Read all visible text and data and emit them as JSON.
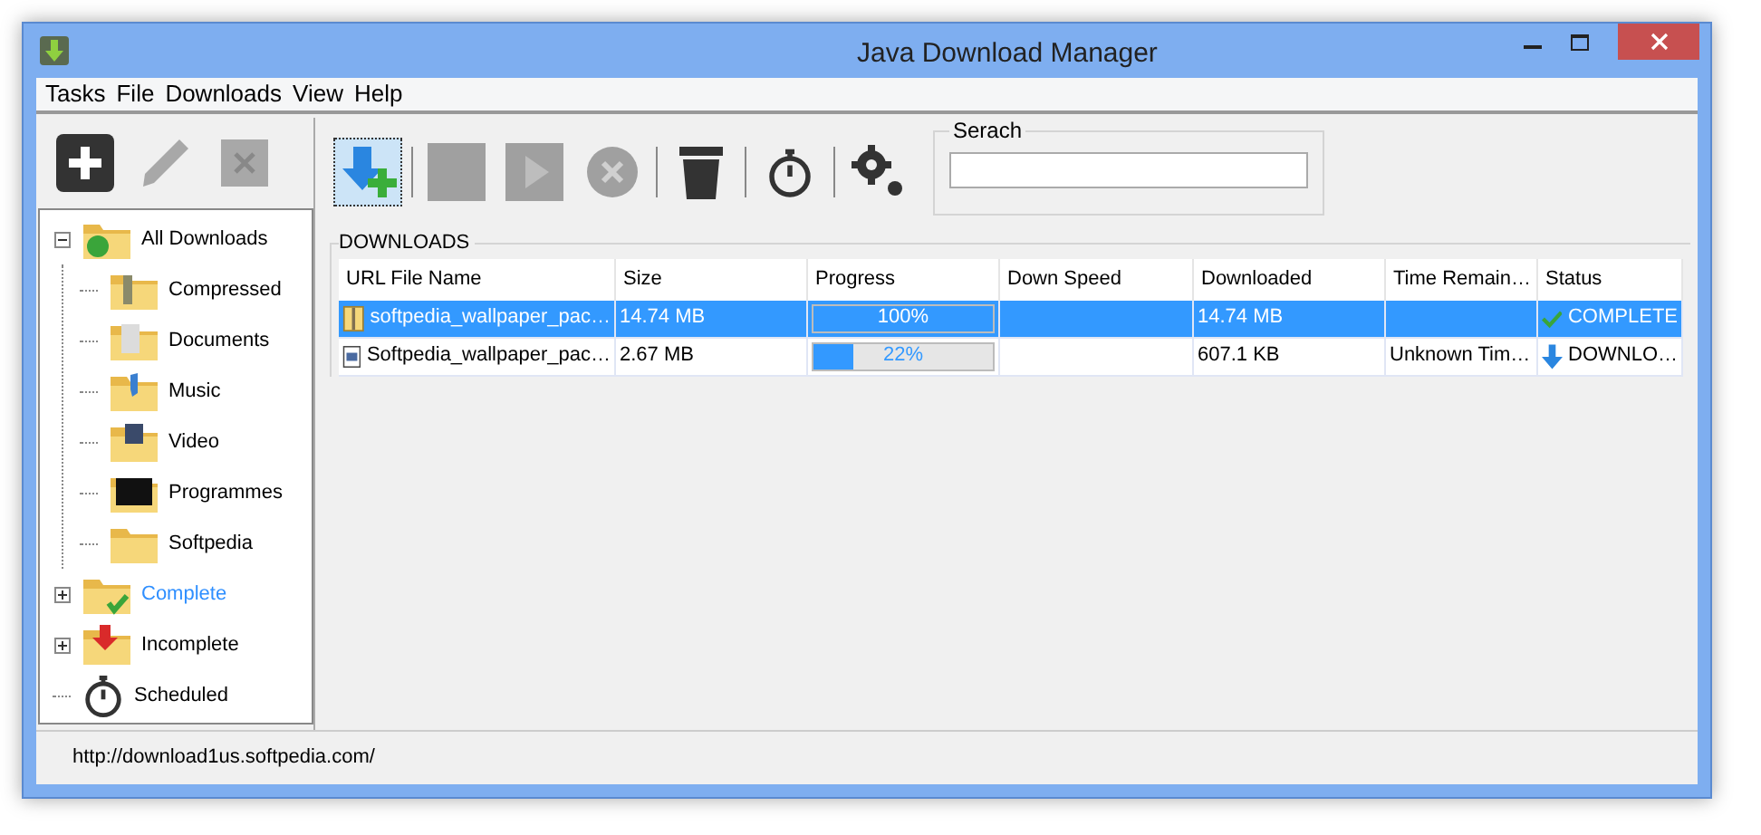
{
  "window": {
    "title": "Java Download Manager"
  },
  "menu": [
    "Tasks",
    "File",
    "Downloads",
    "View",
    "Help"
  ],
  "side_toolbar": [
    {
      "kind": "add",
      "disabled": false
    },
    {
      "kind": "edit",
      "disabled": true
    },
    {
      "kind": "delete",
      "disabled": true
    }
  ],
  "tree": [
    {
      "label": "All Downloads",
      "kind": "all",
      "expanded": true,
      "selected": false,
      "children": [
        {
          "label": "Compressed",
          "kind": "compressed",
          "selected": false
        },
        {
          "label": "Documents",
          "kind": "documents",
          "selected": false
        },
        {
          "label": "Music",
          "kind": "music",
          "selected": false
        },
        {
          "label": "Video",
          "kind": "video",
          "selected": false
        },
        {
          "label": "Programmes",
          "kind": "programmes",
          "selected": false
        },
        {
          "label": "Softpedia",
          "kind": "plain",
          "selected": false
        }
      ]
    },
    {
      "label": "Complete",
      "kind": "complete",
      "expanded": false,
      "selected": true
    },
    {
      "label": "Incomplete",
      "kind": "incomplete",
      "expanded": false,
      "selected": false
    },
    {
      "label": "Scheduled",
      "kind": "scheduled",
      "selected": false
    }
  ],
  "toolbar": [
    {
      "kind": "new",
      "disabled": false,
      "focused": true
    },
    {
      "kind": "pause",
      "disabled": true,
      "focused": false
    },
    {
      "kind": "resume",
      "disabled": true,
      "focused": false
    },
    {
      "kind": "stop",
      "disabled": true,
      "focused": false
    },
    {
      "kind": "trash",
      "disabled": false,
      "focused": false
    },
    {
      "kind": "timer",
      "disabled": false,
      "focused": false
    },
    {
      "kind": "settings",
      "disabled": false,
      "focused": false
    }
  ],
  "search": {
    "label": "Serach"
  },
  "downloads": {
    "title": "DOWNLOADS",
    "columns": [
      "URL File Name",
      "Size",
      "Progress",
      "Down Speed",
      "Downloaded",
      "Time Remain…",
      "Status"
    ],
    "rows": [
      {
        "file": {
          "kind": "archive",
          "name": "softpedia_wallpaper_pac…"
        },
        "size": "14.74 MB",
        "level": 1,
        "progress": "100%",
        "downloaded": "14.74 MB",
        "status": {
          "kind": "complete",
          "label": "COMPLETE"
        },
        "selected": true
      },
      {
        "file": {
          "kind": "document",
          "name": "Softpedia_wallpaper_pac…"
        },
        "size": "2.67 MB",
        "level": 0.22,
        "progress": "22%",
        "downloaded": "607.1 KB",
        "time": "Unknown Tim…",
        "status": {
          "kind": "downloading",
          "label": "DOWNLO…"
        },
        "selected": false
      }
    ]
  },
  "status_bar": "http://download1us.softpedia.com/"
}
